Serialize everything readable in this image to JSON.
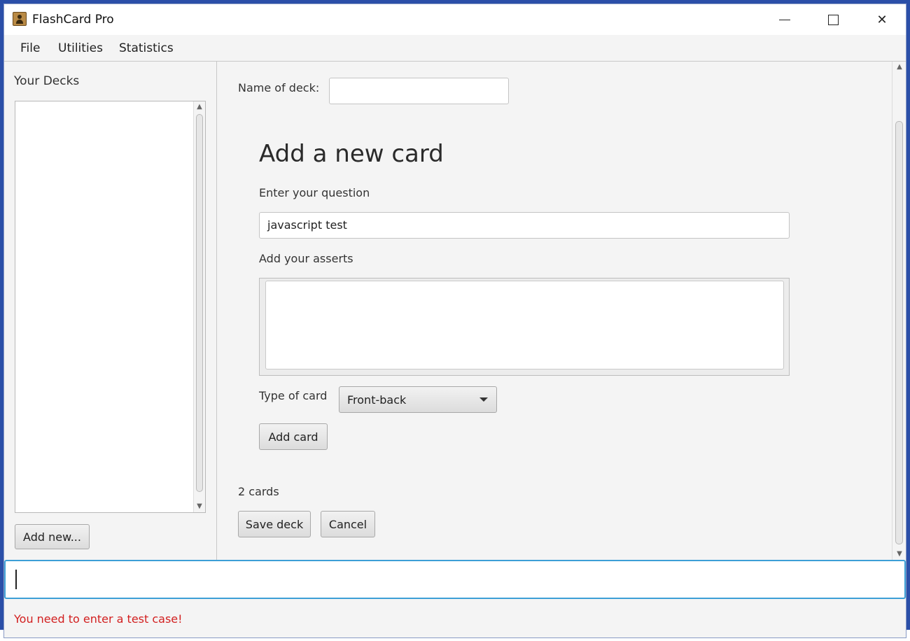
{
  "window": {
    "title": "FlashCard Pro"
  },
  "menu": {
    "file": "File",
    "utilities": "Utilities",
    "statistics": "Statistics"
  },
  "sidebar": {
    "title": "Your Decks",
    "decks": [],
    "add_new_label": "Add new..."
  },
  "editor": {
    "deck_name_label": "Name of deck:",
    "deck_name_value": "",
    "heading": "Add a new card",
    "question_label": "Enter your question",
    "question_value": "javascript test",
    "asserts_label": "Add your asserts",
    "asserts_value": "",
    "type_label": "Type of card",
    "type_selected": "Front-back",
    "add_card_label": "Add card",
    "card_count": "2 cards",
    "save_deck_label": "Save deck",
    "cancel_label": "Cancel"
  },
  "test_case": {
    "value": "",
    "error": "You need to enter a test case!"
  },
  "colors": {
    "error": "#d21f1f",
    "focus_border": "#3c9fd6",
    "background": "#f4f4f4"
  },
  "icons": [
    "app-icon",
    "minimize-icon",
    "maximize-icon",
    "close-icon",
    "chevron-down-icon",
    "scroll-up-icon",
    "scroll-down-icon"
  ]
}
